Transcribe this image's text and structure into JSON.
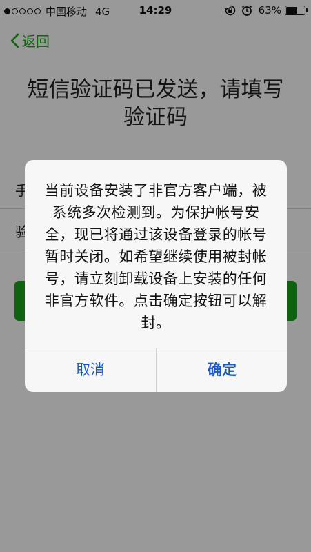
{
  "status_bar": {
    "carrier": "中国移动",
    "network": "4G",
    "time": "14:29",
    "battery_percent": "63%",
    "battery_level": 0.63,
    "signal_filled": 1,
    "signal_total": 5,
    "icons": [
      "orientation-lock-icon",
      "alarm-icon"
    ]
  },
  "nav": {
    "back_label": "返回"
  },
  "page": {
    "title": "短信验证码已发送，请填写验证码",
    "phone_label": "手",
    "code_label": "验"
  },
  "dialog": {
    "message": "当前设备安装了非官方客户端，被系统多次检测到。为保护帐号安全，现已将通过该设备登录的帐号暂时关闭。如希望继续使用被封帐号，请立刻卸载设备上安装的任何非官方软件。点击确定按钮可以解封。",
    "cancel_label": "取消",
    "confirm_label": "确定"
  },
  "colors": {
    "accent_green": "#1aa51a",
    "dialog_button_blue": "#1a56c4",
    "overlay": "rgba(0,0,0,0.40)"
  }
}
